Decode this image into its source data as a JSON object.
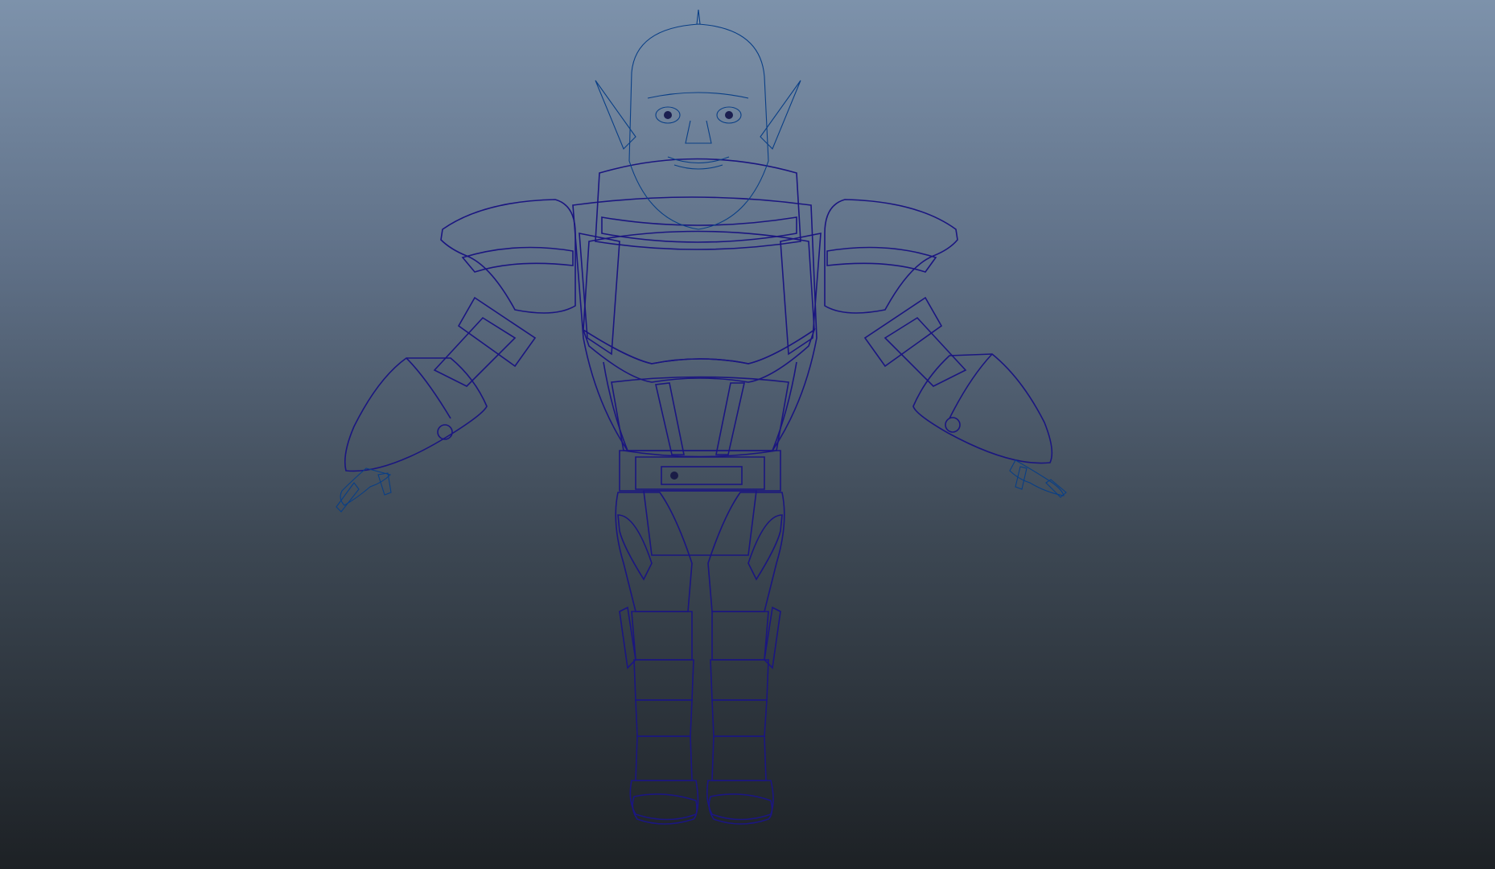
{
  "viewport": {
    "background_top": "#7d92ab",
    "background_bottom": "#1d2125"
  },
  "model": {
    "subject": "armored-alien-character-wireframe",
    "colors": {
      "armor_white": "#e7e4e6",
      "armor_red": "#c9201f",
      "armor_dark": "#1a1c46",
      "skin_blue": "#3ea1dc",
      "wireframe": "#1b1680"
    }
  }
}
